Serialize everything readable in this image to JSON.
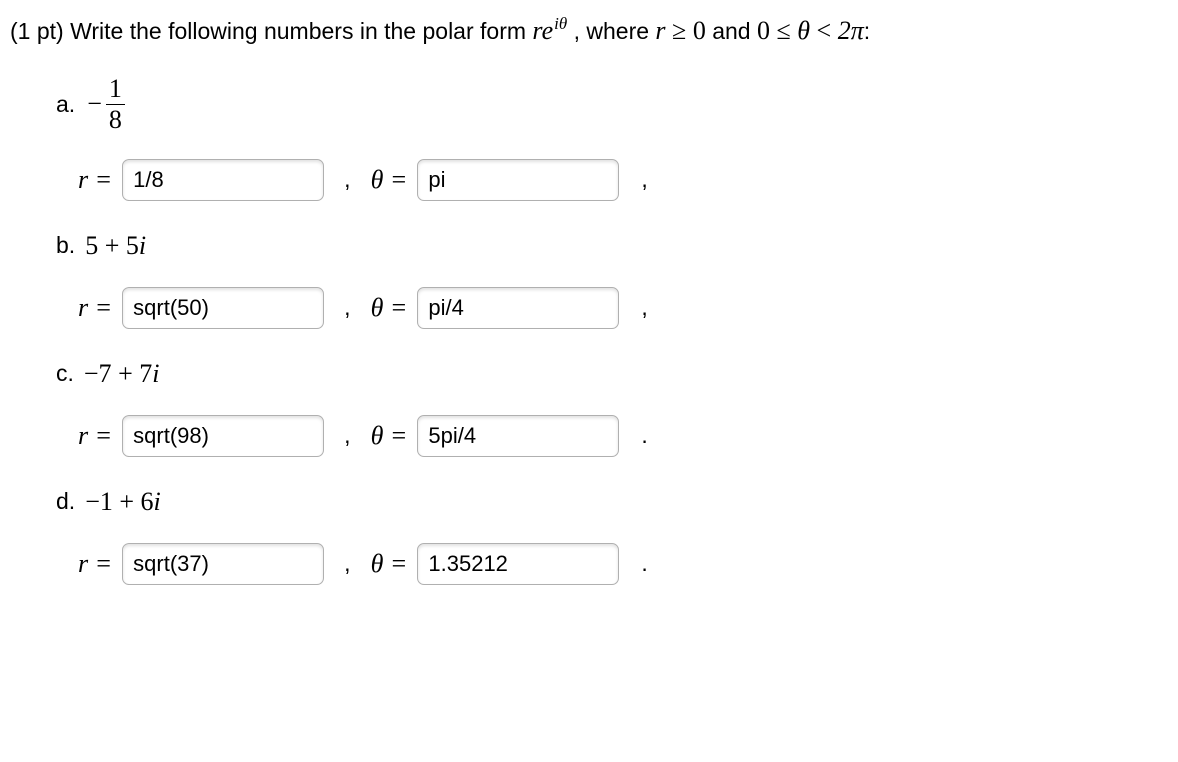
{
  "prompt": {
    "prefix": "(1 pt) Write the following numbers in the polar form ",
    "polar_r": "r",
    "polar_e": "e",
    "polar_exp": "iθ",
    "mid": " , where ",
    "cond1_pre": "r",
    "cond1_rel": " ≥ ",
    "cond1_val": "0",
    "and": " and ",
    "cond2_pre": "0",
    "cond2_rel1": " ≤ ",
    "cond2_mid": "θ",
    "cond2_rel2": " < ",
    "cond2_end": "2π",
    "colon": ":"
  },
  "labels": {
    "r_eq": "r =",
    "theta_eq": "θ ="
  },
  "parts": [
    {
      "letter": "a.",
      "display_type": "frac",
      "neg": "−",
      "num": "1",
      "den": "8",
      "r_value": "1/8",
      "theta_value": "pi",
      "tail": ","
    },
    {
      "letter": "b.",
      "display_type": "expr",
      "expr": "5 + 5i",
      "r_value": "sqrt(50)",
      "theta_value": "pi/4",
      "tail": ","
    },
    {
      "letter": "c.",
      "display_type": "expr",
      "expr": "−7 + 7i",
      "r_value": "sqrt(98)",
      "theta_value": "5pi/4",
      "tail": "."
    },
    {
      "letter": "d.",
      "display_type": "expr",
      "expr": "−1 + 6i",
      "r_value": "sqrt(37)",
      "theta_value": "1.35212",
      "tail": "."
    }
  ],
  "separator": ","
}
